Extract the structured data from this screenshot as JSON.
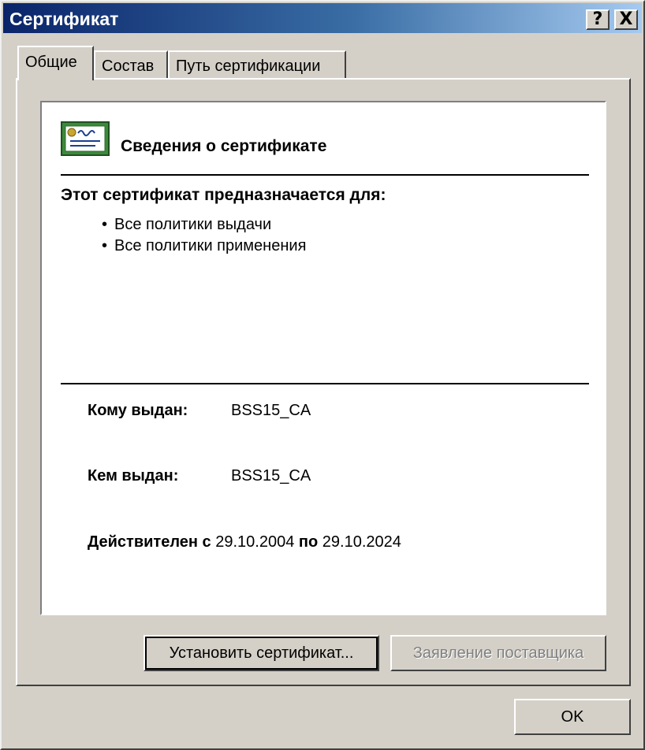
{
  "window": {
    "title": "Сертификат",
    "help_button": "?",
    "close_button": "X"
  },
  "tabs": [
    {
      "label": "Общие",
      "active": true
    },
    {
      "label": "Состав",
      "active": false
    },
    {
      "label": "Путь сертификации",
      "active": false
    }
  ],
  "info": {
    "icon": "certificate-icon",
    "title": "Сведения о сертификате",
    "purpose_heading": "Этот сертификат предназначается для:",
    "purposes": [
      "Все политики выдачи",
      "Все политики применения"
    ],
    "issued_to_label": "Кому выдан:",
    "issued_to": "BSS15_CA",
    "issued_by_label": "Кем выдан:",
    "issued_by": "BSS15_CA",
    "valid_from_label": "Действителен с",
    "valid_from": "29.10.2004",
    "valid_to_label": "по",
    "valid_to": "29.10.2024"
  },
  "buttons": {
    "install": "Установить сертификат...",
    "issuer_statement": "Заявление поставщика",
    "ok": "OK"
  },
  "colors": {
    "dialog_face": "#d4d0c8",
    "titlebar_start": "#0a246a",
    "titlebar_end": "#a6caf0",
    "disabled_text": "#808080"
  }
}
